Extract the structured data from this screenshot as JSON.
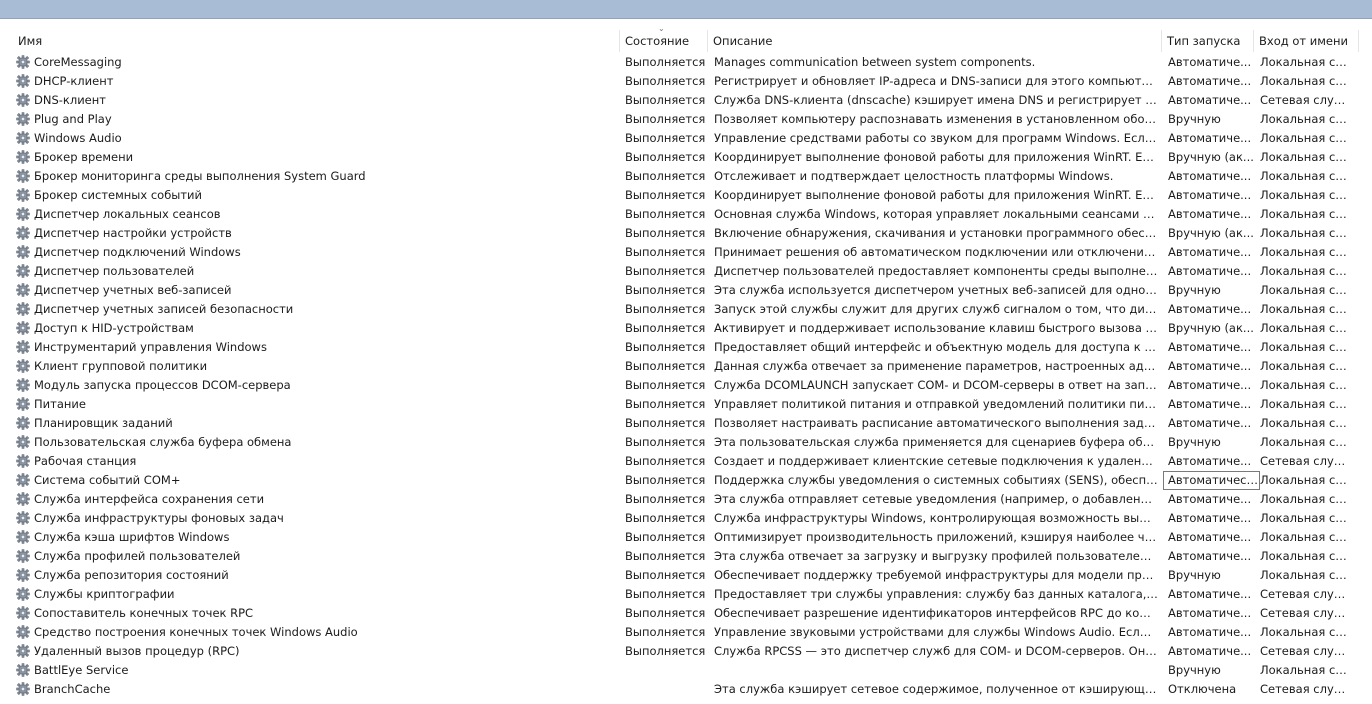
{
  "columns": {
    "name": "Имя",
    "state": "Состояние",
    "description": "Описание",
    "startup": "Тип запуска",
    "logon": "Вход от имени"
  },
  "rows": [
    {
      "name": "CoreMessaging",
      "state": "Выполняется",
      "description": "Manages communication between system components.",
      "startup": "Автоматиче...",
      "logon": "Локальная слу..."
    },
    {
      "name": "DHCP-клиент",
      "state": "Выполняется",
      "description": "Регистрирует и обновляет IP-адреса и DNS-записи для этого компьютера. Ес...",
      "startup": "Автоматиче...",
      "logon": "Локальная слу..."
    },
    {
      "name": "DNS-клиент",
      "state": "Выполняется",
      "description": "Служба DNS-клиента (dnscache) кэширует имена DNS и регистрирует полно...",
      "startup": "Автоматиче...",
      "logon": "Сетевая служба"
    },
    {
      "name": "Plug and Play",
      "state": "Выполняется",
      "description": "Позволяет компьютеру распознавать изменения в установленном оборудов...",
      "startup": "Вручную",
      "logon": "Локальная сис..."
    },
    {
      "name": "Windows Audio",
      "state": "Выполняется",
      "description": "Управление средствами работы со звуком для программ Windows.  Если эта...",
      "startup": "Автоматиче...",
      "logon": "Локальная слу..."
    },
    {
      "name": "Брокер времени",
      "state": "Выполняется",
      "description": "Координирует выполнение фоновой работы для приложения WinRT. Если эт...",
      "startup": "Вручную (ак...",
      "logon": "Локальная слу..."
    },
    {
      "name": "Брокер мониторинга среды выполнения System Guard",
      "state": "Выполняется",
      "description": "Отслеживает и подтверждает целостность платформы Windows.",
      "startup": "Автоматиче...",
      "logon": "Локальная сис..."
    },
    {
      "name": "Брокер системных событий",
      "state": "Выполняется",
      "description": "Координирует выполнение фоновой работы для приложения WinRT. Если эт...",
      "startup": "Автоматиче...",
      "logon": "Локальная сис..."
    },
    {
      "name": "Диспетчер локальных сеансов",
      "state": "Выполняется",
      "description": "Основная служба Windows, которая управляет локальными сеансами польз...",
      "startup": "Автоматиче...",
      "logon": "Локальная сис..."
    },
    {
      "name": "Диспетчер настройки устройств",
      "state": "Выполняется",
      "description": "Включение обнаружения, скачивания и установки программного обеспечен...",
      "startup": "Вручную (ак...",
      "logon": "Локальная сис..."
    },
    {
      "name": "Диспетчер подключений Windows",
      "state": "Выполняется",
      "description": "Принимает решения об автоматическом подключении или отключении, исх...",
      "startup": "Автоматиче...",
      "logon": "Локальная слу..."
    },
    {
      "name": "Диспетчер пользователей",
      "state": "Выполняется",
      "description": "Диспетчер пользователей предоставляет компоненты среды выполнения, н...",
      "startup": "Автоматиче...",
      "logon": "Локальная сис..."
    },
    {
      "name": "Диспетчер учетных веб-записей",
      "state": "Выполняется",
      "description": "Эта служба используется диспетчером учетных веб-записей для однократно...",
      "startup": "Вручную",
      "logon": "Локальная сис..."
    },
    {
      "name": "Диспетчер учетных записей безопасности",
      "state": "Выполняется",
      "description": "Запуск этой службы служит для других служб сигналом о том, что диспетче...",
      "startup": "Автоматиче...",
      "logon": "Локальная сис..."
    },
    {
      "name": "Доступ к HID-устройствам",
      "state": "Выполняется",
      "description": "Активирует и поддерживает использование клавиш быстрого вызова на кла...",
      "startup": "Вручную (ак...",
      "logon": "Локальная сис..."
    },
    {
      "name": "Инструментарий управления Windows",
      "state": "Выполняется",
      "description": "Предоставляет общий интерфейс и объектную модель для доступа к инфор...",
      "startup": "Автоматиче...",
      "logon": "Локальная сис..."
    },
    {
      "name": "Клиент групповой политики",
      "state": "Выполняется",
      "description": "Данная служба отвечает за применение параметров, настроенных админист...",
      "startup": "Автоматиче...",
      "logon": "Локальная сис..."
    },
    {
      "name": "Модуль запуска процессов DCOM-сервера",
      "state": "Выполняется",
      "description": "Служба DCOMLAUNCH запускает COM- и DCOM-серверы в ответ на запросы...",
      "startup": "Автоматиче...",
      "logon": "Локальная сис..."
    },
    {
      "name": "Питание",
      "state": "Выполняется",
      "description": "Управляет политикой питания и отправкой уведомлений политики питания.",
      "startup": "Автоматиче...",
      "logon": "Локальная сис..."
    },
    {
      "name": "Планировщик заданий",
      "state": "Выполняется",
      "description": "Позволяет настраивать расписание автоматического выполнения задач на э...",
      "startup": "Автоматиче...",
      "logon": "Локальная сис..."
    },
    {
      "name": "Пользовательская служба буфера обмена",
      "state": "Выполняется",
      "description": "Эта пользовательская служба применяется для сценариев буфера обмена",
      "startup": "Вручную",
      "logon": "Локальная сис..."
    },
    {
      "name": "Рабочая станция",
      "state": "Выполняется",
      "description": "Создает и поддерживает клиентские сетевые подключения к удаленным сер...",
      "startup": "Автоматиче...",
      "logon": "Сетевая служба"
    },
    {
      "name": "Система событий COM+",
      "state": "Выполняется",
      "description": "Поддержка службы уведомления о системных событиях (SENS), обеспечива...",
      "startup": "Автоматически",
      "logon": "Локальная слу...",
      "focused": true
    },
    {
      "name": "Служба интерфейса сохранения сети",
      "state": "Выполняется",
      "description": "Эта служба отправляет сетевые уведомления (например, о добавлении или ...",
      "startup": "Автоматиче...",
      "logon": "Локальная сис..."
    },
    {
      "name": "Служба инфраструктуры фоновых задач",
      "state": "Выполняется",
      "description": "Служба инфраструктуры Windows, контролирующая возможность выполне...",
      "startup": "Автоматиче...",
      "logon": "Локальная сис..."
    },
    {
      "name": "Служба кэша шрифтов Windows",
      "state": "Выполняется",
      "description": "Оптимизирует производительность приложений, кэшируя наиболее часто и...",
      "startup": "Автоматиче...",
      "logon": "Локальная слу..."
    },
    {
      "name": "Служба профилей пользователей",
      "state": "Выполняется",
      "description": "Эта служба отвечает за загрузку и выгрузку профилей пользователей. Если ...",
      "startup": "Автоматиче...",
      "logon": "Локальная сис..."
    },
    {
      "name": "Служба репозитория состояний",
      "state": "Выполняется",
      "description": "Обеспечивает поддержку требуемой инфраструктуры для модели приложе...",
      "startup": "Вручную",
      "logon": "Локальная сис..."
    },
    {
      "name": "Службы криптографии",
      "state": "Выполняется",
      "description": "Предоставляет три службы управления: службу баз данных каталога, котора...",
      "startup": "Автоматиче...",
      "logon": "Сетевая служба"
    },
    {
      "name": "Сопоставитель конечных точек RPC",
      "state": "Выполняется",
      "description": "Обеспечивает разрешение идентификаторов интерфейсов RPC до конечных ...",
      "startup": "Автоматиче...",
      "logon": "Сетевая служба"
    },
    {
      "name": "Средство построения конечных точек Windows Audio",
      "state": "Выполняется",
      "description": "Управление звуковыми устройствами для службы Windows Audio.  Если эта ...",
      "startup": "Автоматиче...",
      "logon": "Локальная сис..."
    },
    {
      "name": "Удаленный вызов процедур (RPC)",
      "state": "Выполняется",
      "description": "Служба RPCSS — это диспетчер служб для COM- и DCOM-серверов. Она вы...",
      "startup": "Автоматиче...",
      "logon": "Сетевая служба"
    },
    {
      "name": "BattlEye Service",
      "state": "",
      "description": "",
      "startup": "Вручную",
      "logon": "Локальная сис..."
    },
    {
      "name": "BranchCache",
      "state": "",
      "description": "Эта служба кэширует сетевое содержимое, полученное от кэширующих узл...",
      "startup": "Отключена",
      "logon": "Сетевая служба"
    }
  ]
}
